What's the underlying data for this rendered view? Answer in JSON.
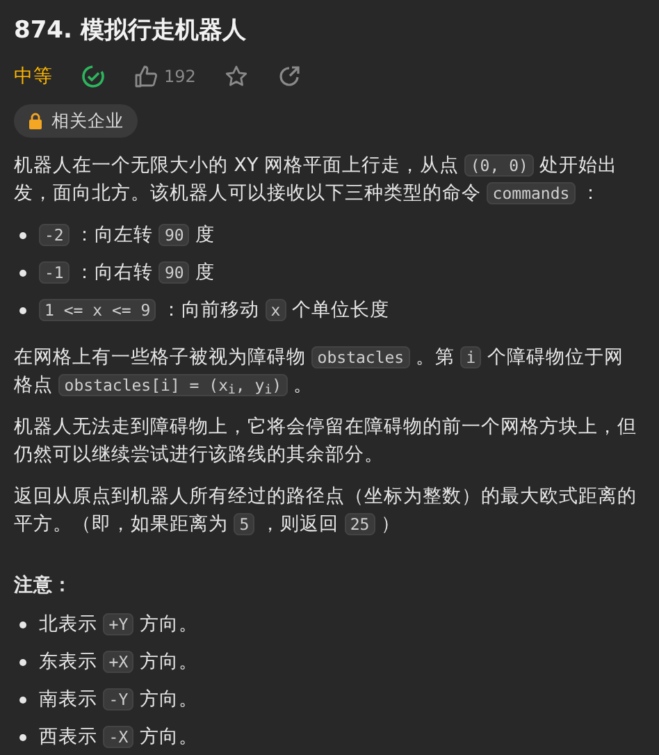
{
  "title": "874. 模拟行走机器人",
  "meta": {
    "difficulty": "中等",
    "solved": true,
    "likes": "192",
    "starred": false
  },
  "tag": {
    "label": "相关企业"
  },
  "content": [
    {
      "kind": "paragraph",
      "parts": [
        {
          "kind": "text",
          "text": "机器人在一个无限大小的 XY 网格平面上行走，从点 "
        },
        {
          "kind": "code",
          "text": "(0, 0)"
        },
        {
          "kind": "text",
          "text": " 处开始出发，面向北方。该机器人可以接收以下三种类型的命令 "
        },
        {
          "kind": "code",
          "text": "commands"
        },
        {
          "kind": "text",
          "text": " ："
        }
      ]
    },
    {
      "kind": "list",
      "items": [
        {
          "parts": [
            {
              "kind": "code",
              "text": "-2"
            },
            {
              "kind": "text",
              "text": " ：向左转 "
            },
            {
              "kind": "code",
              "text": "90"
            },
            {
              "kind": "text",
              "text": " 度"
            }
          ]
        },
        {
          "parts": [
            {
              "kind": "code",
              "text": "-1"
            },
            {
              "kind": "text",
              "text": " ：向右转 "
            },
            {
              "kind": "code",
              "text": "90"
            },
            {
              "kind": "text",
              "text": " 度"
            }
          ]
        },
        {
          "parts": [
            {
              "kind": "code",
              "text": "1 <= x <= 9"
            },
            {
              "kind": "text",
              "text": " ：向前移动 "
            },
            {
              "kind": "code",
              "text": "x"
            },
            {
              "kind": "text",
              "text": " 个单位长度"
            }
          ]
        }
      ]
    },
    {
      "kind": "paragraph",
      "parts": [
        {
          "kind": "text",
          "text": "在网格上有一些格子被视为障碍物 "
        },
        {
          "kind": "code",
          "text": "obstacles"
        },
        {
          "kind": "text",
          "text": " 。第 "
        },
        {
          "kind": "code",
          "text": "i"
        },
        {
          "kind": "text",
          "text": " 个障碍物位于网格点 "
        },
        {
          "kind": "code",
          "text": "obstacles[i] = (x$_{i}$, y$_{i}$)"
        },
        {
          "kind": "text",
          "text": " 。"
        }
      ]
    },
    {
      "kind": "paragraph",
      "parts": [
        {
          "kind": "text",
          "text": "机器人无法走到障碍物上，它将会停留在障碍物的前一个网格方块上，但仍然可以继续尝试进行该路线的其余部分。"
        }
      ]
    },
    {
      "kind": "paragraph",
      "parts": [
        {
          "kind": "text",
          "text": "返回从原点到机器人所有经过的路径点（坐标为整数）的最大欧式距离的平方。（即，如果距离为 "
        },
        {
          "kind": "code",
          "text": "5"
        },
        {
          "kind": "text",
          "text": " ，则返回 "
        },
        {
          "kind": "code",
          "text": "25"
        },
        {
          "kind": "text",
          "text": " ）"
        }
      ]
    },
    {
      "kind": "heading",
      "text": "注意："
    },
    {
      "kind": "list",
      "items": [
        {
          "parts": [
            {
              "kind": "text",
              "text": "北表示 "
            },
            {
              "kind": "code",
              "text": "+Y"
            },
            {
              "kind": "text",
              "text": " 方向。"
            }
          ]
        },
        {
          "parts": [
            {
              "kind": "text",
              "text": "东表示 "
            },
            {
              "kind": "code",
              "text": "+X"
            },
            {
              "kind": "text",
              "text": " 方向。"
            }
          ]
        },
        {
          "parts": [
            {
              "kind": "text",
              "text": "南表示 "
            },
            {
              "kind": "code",
              "text": "-Y"
            },
            {
              "kind": "text",
              "text": " 方向。"
            }
          ]
        },
        {
          "parts": [
            {
              "kind": "text",
              "text": "西表示 "
            },
            {
              "kind": "code",
              "text": "-X"
            },
            {
              "kind": "text",
              "text": " 方向。"
            }
          ]
        }
      ]
    }
  ]
}
